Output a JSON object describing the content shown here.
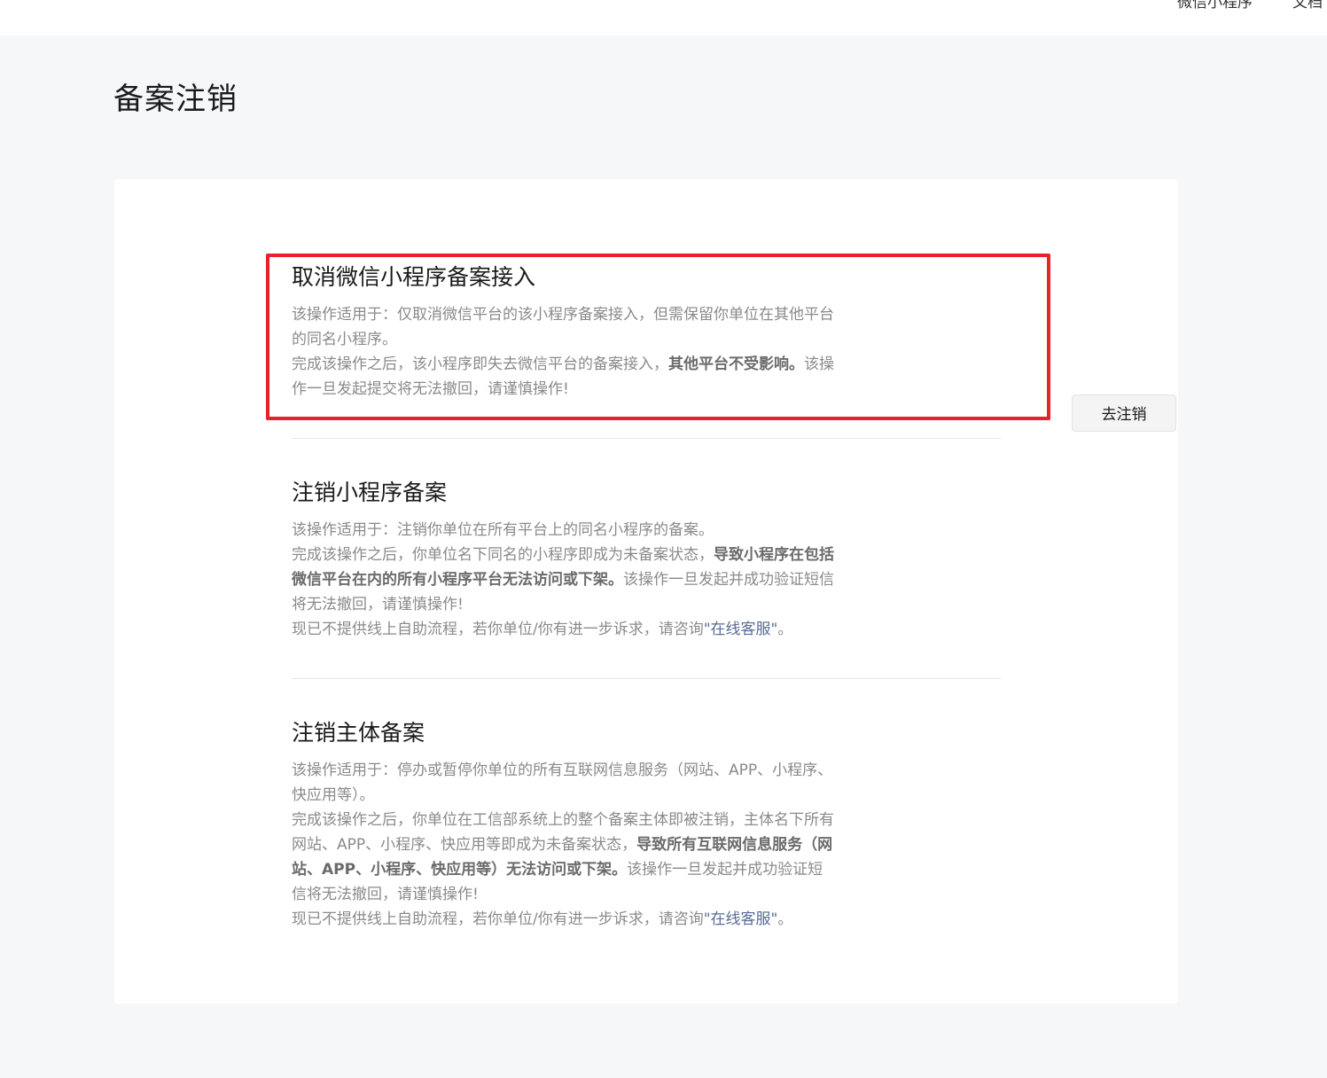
{
  "header": {
    "nav_items": [
      "微信小程序",
      "文档"
    ]
  },
  "page": {
    "title": "备案注销"
  },
  "sections": [
    {
      "title": "取消微信小程序备案接入",
      "p1": "该操作适用于：仅取消微信平台的该小程序备案接入，但需保留你单位在其他平台的同名小程序。",
      "p2_pre": "完成该操作之后，该小程序即失去微信平台的备案接入，",
      "p2_bold": "其他平台不受影响。",
      "p2_post": "该操作一旦发起提交将无法撤回，请谨慎操作!",
      "button_label": "去注销"
    },
    {
      "title": "注销小程序备案",
      "p1": "该操作适用于：注销你单位在所有平台上的同名小程序的备案。",
      "p2_pre": "完成该操作之后，你单位名下同名的小程序即成为未备案状态，",
      "p2_bold": "导致小程序在包括微信平台在内的所有小程序平台无法访问或下架。",
      "p2_post": "该操作一旦发起并成功验证短信将无法撤回，请谨慎操作!",
      "p3_pre": "现已不提供线上自助流程，若你单位/你有进一步诉求，请咨询",
      "p3_link": "\"在线客服\"",
      "p3_post": "。"
    },
    {
      "title": "注销主体备案",
      "p1": "该操作适用于：停办或暂停你单位的所有互联网信息服务（网站、APP、小程序、快应用等）。",
      "p2_pre": "完成该操作之后，你单位在工信部系统上的整个备案主体即被注销，主体名下所有网站、APP、小程序、快应用等即成为未备案状态，",
      "p2_bold": "导致所有互联网信息服务（网站、APP、小程序、快应用等）无法访问或下架。",
      "p2_post": "该操作一旦发起并成功验证短信将无法撤回，请谨慎操作!",
      "p3_pre": "现已不提供线上自助流程，若你单位/你有进一步诉求，请咨询",
      "p3_link": "\"在线客服\"",
      "p3_post": "。"
    }
  ],
  "colors": {
    "highlight_border": "#e8222a",
    "link": "#576b95",
    "page_bg": "#f6f7f9"
  }
}
